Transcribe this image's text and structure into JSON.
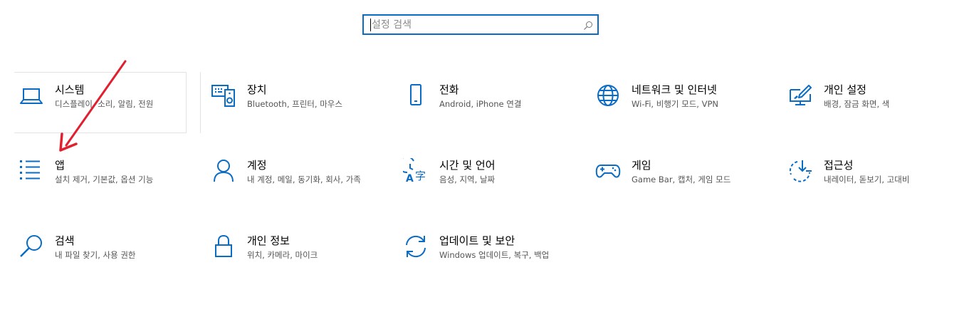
{
  "search": {
    "placeholder": "설정 검색",
    "value": ""
  },
  "tiles": [
    {
      "title": "시스템",
      "desc": "디스플레이, 소리, 알림, 전원",
      "icon": "laptop-icon"
    },
    {
      "title": "장치",
      "desc": "Bluetooth, 프린터, 마우스",
      "icon": "devices-icon"
    },
    {
      "title": "전화",
      "desc": "Android, iPhone 연결",
      "icon": "phone-icon"
    },
    {
      "title": "네트워크 및 인터넷",
      "desc": "Wi-Fi, 비행기 모드, VPN",
      "icon": "globe-icon"
    },
    {
      "title": "개인 설정",
      "desc": "배경, 잠금 화면, 색",
      "icon": "personalization-icon"
    },
    {
      "title": "앱",
      "desc": "설치 제거, 기본값, 옵션 기능",
      "icon": "apps-list-icon"
    },
    {
      "title": "계정",
      "desc": "내 계정, 메일, 동기화, 회사, 가족",
      "icon": "person-icon"
    },
    {
      "title": "시간 및 언어",
      "desc": "음성, 지역, 날짜",
      "icon": "time-language-icon"
    },
    {
      "title": "게임",
      "desc": "Game Bar, 캡처, 게임 모드",
      "icon": "gamepad-icon"
    },
    {
      "title": "접근성",
      "desc": "내레이터, 돋보기, 고대비",
      "icon": "accessibility-icon"
    },
    {
      "title": "검색",
      "desc": "내 파일 찾기, 사용 권한",
      "icon": "search-icon"
    },
    {
      "title": "개인 정보",
      "desc": "위치, 카메라, 마이크",
      "icon": "lock-icon"
    },
    {
      "title": "업데이트 및 보안",
      "desc": "Windows 업데이트, 복구, 백업",
      "icon": "update-icon"
    }
  ],
  "colors": {
    "accent": "#0a6cc4",
    "arrow": "#e0202e"
  }
}
